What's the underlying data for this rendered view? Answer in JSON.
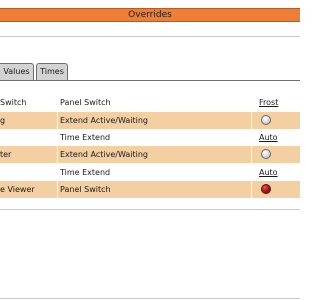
{
  "window": {
    "title": "Overrides"
  },
  "tabs": [
    {
      "label": "Values"
    },
    {
      "label": "Times"
    }
  ],
  "table": {
    "rows": [
      {
        "name": "Switch",
        "type": "Panel Switch",
        "state": "Frost",
        "control": "link",
        "highlight": false
      },
      {
        "name": "g",
        "type": "Extend Active/Waiting",
        "state": "",
        "control": "indicator-grey",
        "highlight": true
      },
      {
        "name": "",
        "type": "Time Extend",
        "state": "Auto",
        "control": "link",
        "highlight": false
      },
      {
        "name": "ter",
        "type": "Extend Active/Waiting",
        "state": "",
        "control": "indicator-grey",
        "highlight": true
      },
      {
        "name": "",
        "type": "Time Extend",
        "state": "Auto",
        "control": "link",
        "highlight": false
      },
      {
        "name": "e Viewer",
        "type": "Panel Switch",
        "state": "",
        "control": "indicator-red",
        "highlight": true
      }
    ]
  },
  "colors": {
    "title_bar": "#ee7d36",
    "row_highlight": "#f4cfa2",
    "indicator_off": "#d0d0d0",
    "indicator_on": "#b01c1c"
  }
}
